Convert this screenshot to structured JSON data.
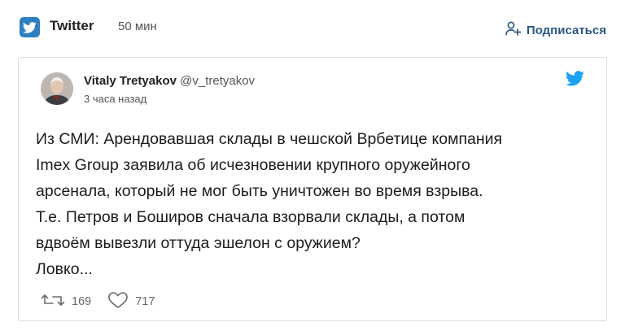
{
  "header": {
    "source_name": "Twitter",
    "post_time": "50 мин",
    "subscribe_label": "Подписаться"
  },
  "tweet": {
    "author_name": "Vitaly Tretyakov",
    "author_handle": "@v_tretyakov",
    "posted_ago": "3 часа назад",
    "text": "Из СМИ: Арендовавшая склады в чешской Врбетице компания\nImex Group заявила об исчезновении крупного оружейного\nарсенала, который не мог быть уничтожен во время взрыва.\nТ.е. Петров и Боширов сначала взорвали склады, а потом\nвдвоём вывезли оттуда эшелон с оружием?\nЛовко...",
    "retweets": "169",
    "likes": "717"
  },
  "colors": {
    "twitter_blue": "#1da1f2",
    "badge_blue": "#2f7fbf",
    "link_blue": "#2a5885"
  },
  "icons": [
    "twitter-bird-icon",
    "add-person-icon",
    "retweet-icon",
    "heart-icon"
  ]
}
